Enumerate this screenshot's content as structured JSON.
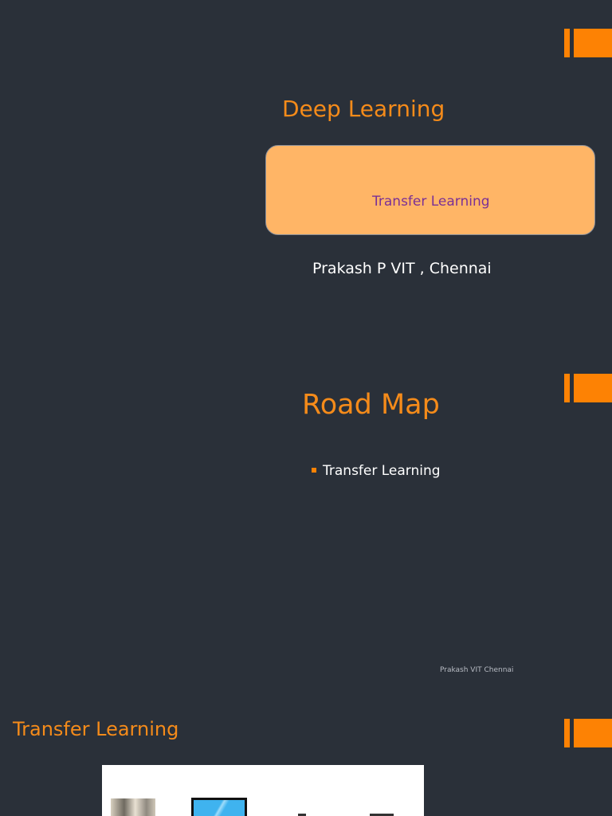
{
  "slide1": {
    "title": "Deep Learning",
    "subtitle": "Transfer Learning",
    "author": "Prakash P VIT , Chennai"
  },
  "slide2": {
    "title": "Road Map",
    "bullets": [
      "Transfer Learning"
    ],
    "footer": "Prakash VIT Chennai"
  },
  "slide3": {
    "title": "Transfer Learning"
  },
  "colors": {
    "background": "#2a3039",
    "accent": "#fd8204",
    "title": "#f58b1a",
    "subtitle_box": "#ffb566",
    "subtitle_text": "#7a3096"
  }
}
